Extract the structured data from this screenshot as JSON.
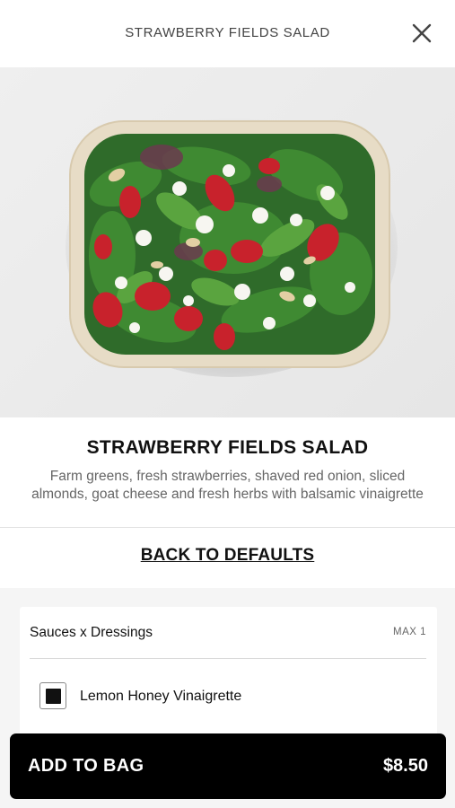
{
  "header": {
    "title": "STRAWBERRY FIELDS SALAD",
    "close_icon": "close-icon"
  },
  "hero": {
    "image_icon": "salad-photo"
  },
  "product": {
    "title": "STRAWBERRY FIELDS SALAD",
    "description": "Farm greens, fresh strawberries, shaved red onion, sliced almonds, goat cheese and fresh herbs with balsamic vinaigrette",
    "back_to_defaults": "BACK TO DEFAULTS"
  },
  "customizer": {
    "group_title": "Sauces x Dressings",
    "max_label": "MAX 1",
    "options": [
      {
        "label": "Lemon Honey Vinaigrette",
        "checked": true
      }
    ]
  },
  "cart": {
    "add_label": "ADD TO BAG",
    "price": "$8.50"
  },
  "colors": {
    "primary": "#000000",
    "background": "#f5f5f5",
    "text_muted": "#666666"
  }
}
